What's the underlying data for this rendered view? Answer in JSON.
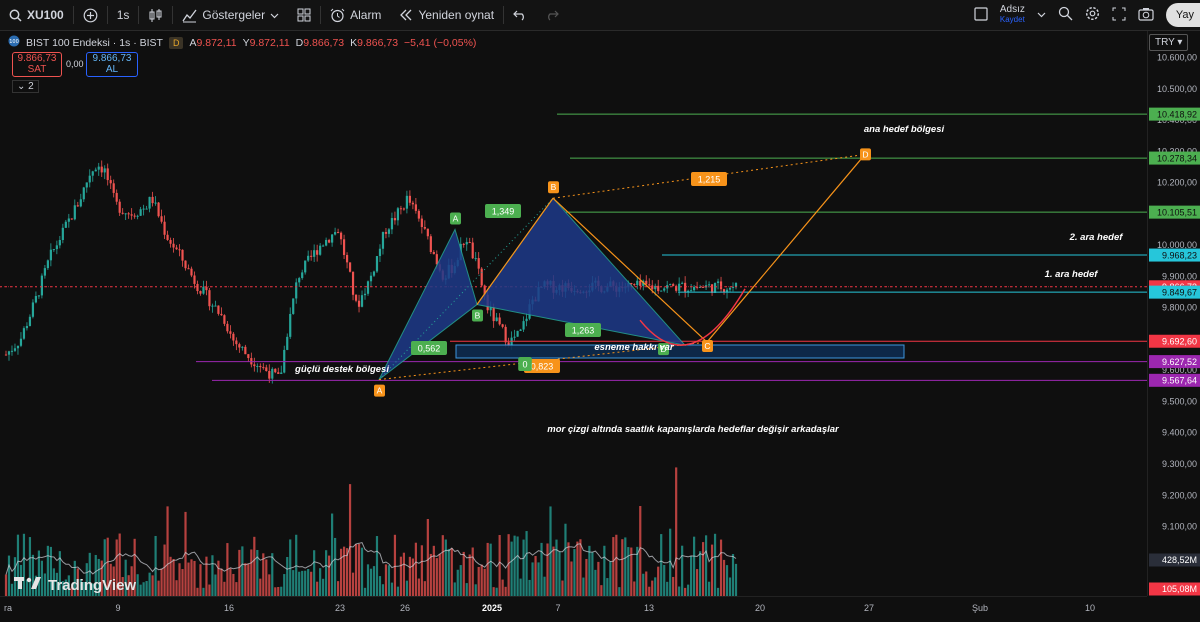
{
  "topbar": {
    "symbol": "XU100",
    "interval": "1s",
    "indicators_label": "Göstergeler",
    "alarm_label": "Alarm",
    "replay_label": "Yeniden oynat",
    "user_name": "Adsız",
    "user_sub": "Kaydet",
    "publish_label": "Yay"
  },
  "legend": {
    "title": "BIST 100 Endeksi · 1s · BIST",
    "badge": "D",
    "a_label": "A",
    "a_value": "9.872,11",
    "y_label": "Y",
    "y_value": "9.872,11",
    "d_label": "D",
    "d_value": "9.866,73",
    "k_label": "K",
    "k_value": "9.866,73",
    "change": "−5,41 (−0,05%)"
  },
  "trade": {
    "sell_value": "9.866,73",
    "sell_label": "SAT",
    "spread": "0,00",
    "buy_value": "9.866,73",
    "buy_label": "AL",
    "collapse_count": "2"
  },
  "currency": "TRY",
  "brand": "TradingView",
  "colors": {
    "up": "#26a69a",
    "down": "#ef5350",
    "green_level": "#4caf50",
    "cyan_level": "#26c6da",
    "red_level": "#f23645",
    "purple_level": "#9c27b0",
    "pattern_line": "#f7931a",
    "pattern_fill": "#1e3a8a"
  },
  "chart_data": {
    "type": "candlestick",
    "symbol": "XU100",
    "interval": "1h",
    "ylim": [
      9000,
      10650
    ],
    "yticks": [
      {
        "value": 10600,
        "label": "10.600,00"
      },
      {
        "value": 10500,
        "label": "10.500,00"
      },
      {
        "value": 10400,
        "label": "10.400,00"
      },
      {
        "value": 10300,
        "label": "10.300,00"
      },
      {
        "value": 10200,
        "label": "10.200,00"
      },
      {
        "value": 10100,
        "label": "10.100,00"
      },
      {
        "value": 10000,
        "label": "10.000,00"
      },
      {
        "value": 9900,
        "label": "9.900,00"
      },
      {
        "value": 9800,
        "label": "9.800,00"
      },
      {
        "value": 9700,
        "label": "9.700,00"
      },
      {
        "value": 9600,
        "label": "9.600,00"
      },
      {
        "value": 9500,
        "label": "9.500,00"
      },
      {
        "value": 9400,
        "label": "9.400,00"
      },
      {
        "value": 9300,
        "label": "9.300,00"
      },
      {
        "value": 9200,
        "label": "9.200,00"
      },
      {
        "value": 9100,
        "label": "9.100,00"
      }
    ],
    "xticks": [
      "ra",
      "9",
      "16",
      "23",
      "26",
      "2025",
      "7",
      "13",
      "20",
      "27",
      "Şub",
      "10"
    ],
    "price_path": [
      [
        0.0,
        9650
      ],
      [
        0.02,
        9700
      ],
      [
        0.04,
        9820
      ],
      [
        0.06,
        9960
      ],
      [
        0.08,
        10050
      ],
      [
        0.1,
        10140
      ],
      [
        0.115,
        10230
      ],
      [
        0.125,
        10260
      ],
      [
        0.135,
        10240
      ],
      [
        0.15,
        10130
      ],
      [
        0.17,
        10100
      ],
      [
        0.19,
        10120
      ],
      [
        0.2,
        10150
      ],
      [
        0.22,
        10030
      ],
      [
        0.24,
        9960
      ],
      [
        0.26,
        9880
      ],
      [
        0.28,
        9820
      ],
      [
        0.3,
        9760
      ],
      [
        0.31,
        9700
      ],
      [
        0.33,
        9650
      ],
      [
        0.35,
        9610
      ],
      [
        0.375,
        9570
      ],
      [
        0.385,
        9720
      ],
      [
        0.4,
        9900
      ],
      [
        0.43,
        10000
      ],
      [
        0.455,
        10050
      ],
      [
        0.47,
        9910
      ],
      [
        0.48,
        9800
      ],
      [
        0.5,
        9900
      ],
      [
        0.52,
        10050
      ],
      [
        0.54,
        10110
      ],
      [
        0.55,
        10150
      ],
      [
        0.57,
        10060
      ],
      [
        0.59,
        9950
      ],
      [
        0.6,
        9900
      ],
      [
        0.615,
        9940
      ],
      [
        0.63,
        10030
      ],
      [
        0.645,
        9930
      ],
      [
        0.66,
        9800
      ],
      [
        0.675,
        9740
      ],
      [
        0.69,
        9690
      ],
      [
        0.705,
        9720
      ],
      [
        0.72,
        9820
      ],
      [
        0.735,
        9866.73
      ]
    ],
    "volume": {
      "labels": [
        {
          "value": "428,52M"
        },
        {
          "value": "105,08M"
        }
      ]
    },
    "levels": [
      {
        "value": 10418.92,
        "label": "10.418,92",
        "color": "#4caf50"
      },
      {
        "value": 10278.34,
        "label": "10.278,34",
        "color": "#4caf50"
      },
      {
        "value": 10105.51,
        "label": "10.105,51",
        "color": "#4caf50"
      },
      {
        "value": 9968.23,
        "label": "9.968,23",
        "color": "#26c6da"
      },
      {
        "value": 9866.73,
        "label": "9.866,73",
        "color": "#f23645"
      },
      {
        "value": 9849.67,
        "label": "9.849,67",
        "color": "#26c6da"
      },
      {
        "value": 9692.6,
        "label": "9.692,60",
        "color": "#f23645"
      },
      {
        "value": 9627.52,
        "label": "9.627,52",
        "color": "#9c27b0"
      },
      {
        "value": 9567.64,
        "label": "9.567,64",
        "color": "#9c27b0"
      }
    ],
    "pattern_points": [
      {
        "name": "A",
        "value": 9570
      },
      {
        "name": "A",
        "value": 10050
      },
      {
        "name": "B",
        "value": 9810
      },
      {
        "name": "B",
        "value": 10150
      },
      {
        "name": "D",
        "value": 9680
      },
      {
        "name": "C",
        "value": 9690
      },
      {
        "name": "D",
        "value": 10290
      }
    ],
    "ratios": [
      "1,349",
      "0,562",
      "1,263",
      "0,823",
      "0",
      "1,215"
    ],
    "annotations": [
      {
        "text": "ana hedef bölgesi"
      },
      {
        "text": "2. ara hedef"
      },
      {
        "text": "1. ara hedef"
      },
      {
        "text": "esneme hakkı var"
      },
      {
        "text": "güçlü  destek bölgesi"
      },
      {
        "text": "mor çizgi altında saatlık kapanışlarda hedeflar değişir arkadaşlar"
      }
    ]
  }
}
